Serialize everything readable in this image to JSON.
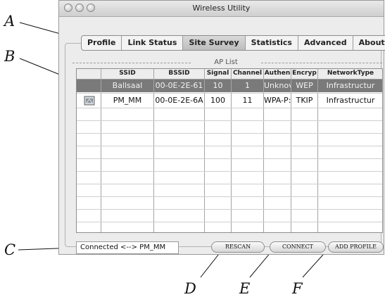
{
  "window": {
    "title": "Wireless Utility"
  },
  "tabs": [
    {
      "label": "Profile"
    },
    {
      "label": "Link Status"
    },
    {
      "label": "Site Survey",
      "active": true
    },
    {
      "label": "Statistics"
    },
    {
      "label": "Advanced"
    },
    {
      "label": "About"
    }
  ],
  "aplist": {
    "title": "AP List",
    "columns": [
      "",
      "SSID",
      "BSSID",
      "Signal",
      "Channel",
      "Authen",
      "Encryp",
      "NetworkType"
    ],
    "rows": [
      {
        "ssid": "Ballsaal",
        "bssid": "00-0E-2E-61",
        "signal": "10",
        "channel": "1",
        "authen": "Unknov",
        "encryp": "WEP",
        "network_type": "Infrastructur",
        "selected": true
      },
      {
        "ssid": "PM_MM",
        "bssid": "00-0E-2E-6A",
        "signal": "100",
        "channel": "11",
        "authen": "WPA-P:",
        "encryp": "TKIP",
        "network_type": "Infrastructur",
        "selected": false,
        "icon": "signal-icon"
      }
    ]
  },
  "status": {
    "text": "Connected <--> PM_MM"
  },
  "buttons": {
    "rescan": "RESCAN",
    "connect": "CONNECT",
    "add_profile": "ADD PROFILE"
  },
  "callouts": {
    "a": "A",
    "b": "B",
    "c": "C",
    "d": "D",
    "e": "E",
    "f": "F"
  }
}
